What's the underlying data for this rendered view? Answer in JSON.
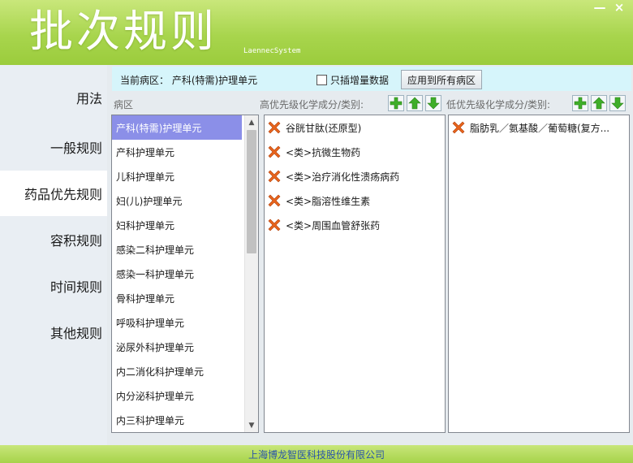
{
  "window": {
    "title": "批次规则",
    "subtitle": "LaennecSystem",
    "minimize_glyph": "—",
    "close_glyph": "×"
  },
  "sidebar": {
    "items": [
      {
        "label": "用法",
        "active": false
      },
      {
        "label": "一般规则",
        "active": false
      },
      {
        "label": "药品优先规则",
        "active": true
      },
      {
        "label": "容积规则",
        "active": false
      },
      {
        "label": "时间规则",
        "active": false
      },
      {
        "label": "其他规则",
        "active": false
      }
    ]
  },
  "toolbar": {
    "current_ward_text": "当前病区：  产科(特需)护理单元",
    "incremental_only_label": "只插增量数据",
    "incremental_only_checked": false,
    "apply_all_label": "应用到所有病区"
  },
  "columns": {
    "ward_label": "病区",
    "high_label": "高优先级化学成分/类别:",
    "low_label": "低优先级化学成分/类别:"
  },
  "wards": [
    {
      "name": "产科(特需)护理单元",
      "selected": true
    },
    {
      "name": "产科护理单元",
      "selected": false
    },
    {
      "name": "儿科护理单元",
      "selected": false
    },
    {
      "name": "妇(儿)护理单元",
      "selected": false
    },
    {
      "name": "妇科护理单元",
      "selected": false
    },
    {
      "name": "感染二科护理单元",
      "selected": false
    },
    {
      "name": "感染一科护理单元",
      "selected": false
    },
    {
      "name": "骨科护理单元",
      "selected": false
    },
    {
      "name": "呼吸科护理单元",
      "selected": false
    },
    {
      "name": "泌尿外科护理单元",
      "selected": false
    },
    {
      "name": "内二消化科护理单元",
      "selected": false
    },
    {
      "name": "内分泌科护理单元",
      "selected": false
    },
    {
      "name": "内三科护理单元",
      "selected": false
    }
  ],
  "high_priority": [
    {
      "name": "谷胱甘肽(还原型)"
    },
    {
      "name": "<类>抗微生物药"
    },
    {
      "name": "<类>治疗消化性溃疡病药"
    },
    {
      "name": "<类>脂溶性维生素"
    },
    {
      "name": "<类>周围血管舒张药"
    }
  ],
  "low_priority": [
    {
      "name": "脂肪乳／氨基酸／葡萄糖(复方..."
    }
  ],
  "icons": {
    "add": "plus-icon",
    "up": "arrow-up-icon",
    "down": "arrow-down-icon",
    "remove": "remove-x-icon"
  },
  "colors": {
    "header_green": "#a8d54d",
    "selection": "#8b8fe8",
    "topbar_cyan": "#d6f5fb",
    "remove_orange": "#e8641c",
    "icon_green": "#3fae29",
    "footer_text": "#2b55a8"
  },
  "footer": {
    "company": "上海博龙智医科技股份有限公司"
  }
}
